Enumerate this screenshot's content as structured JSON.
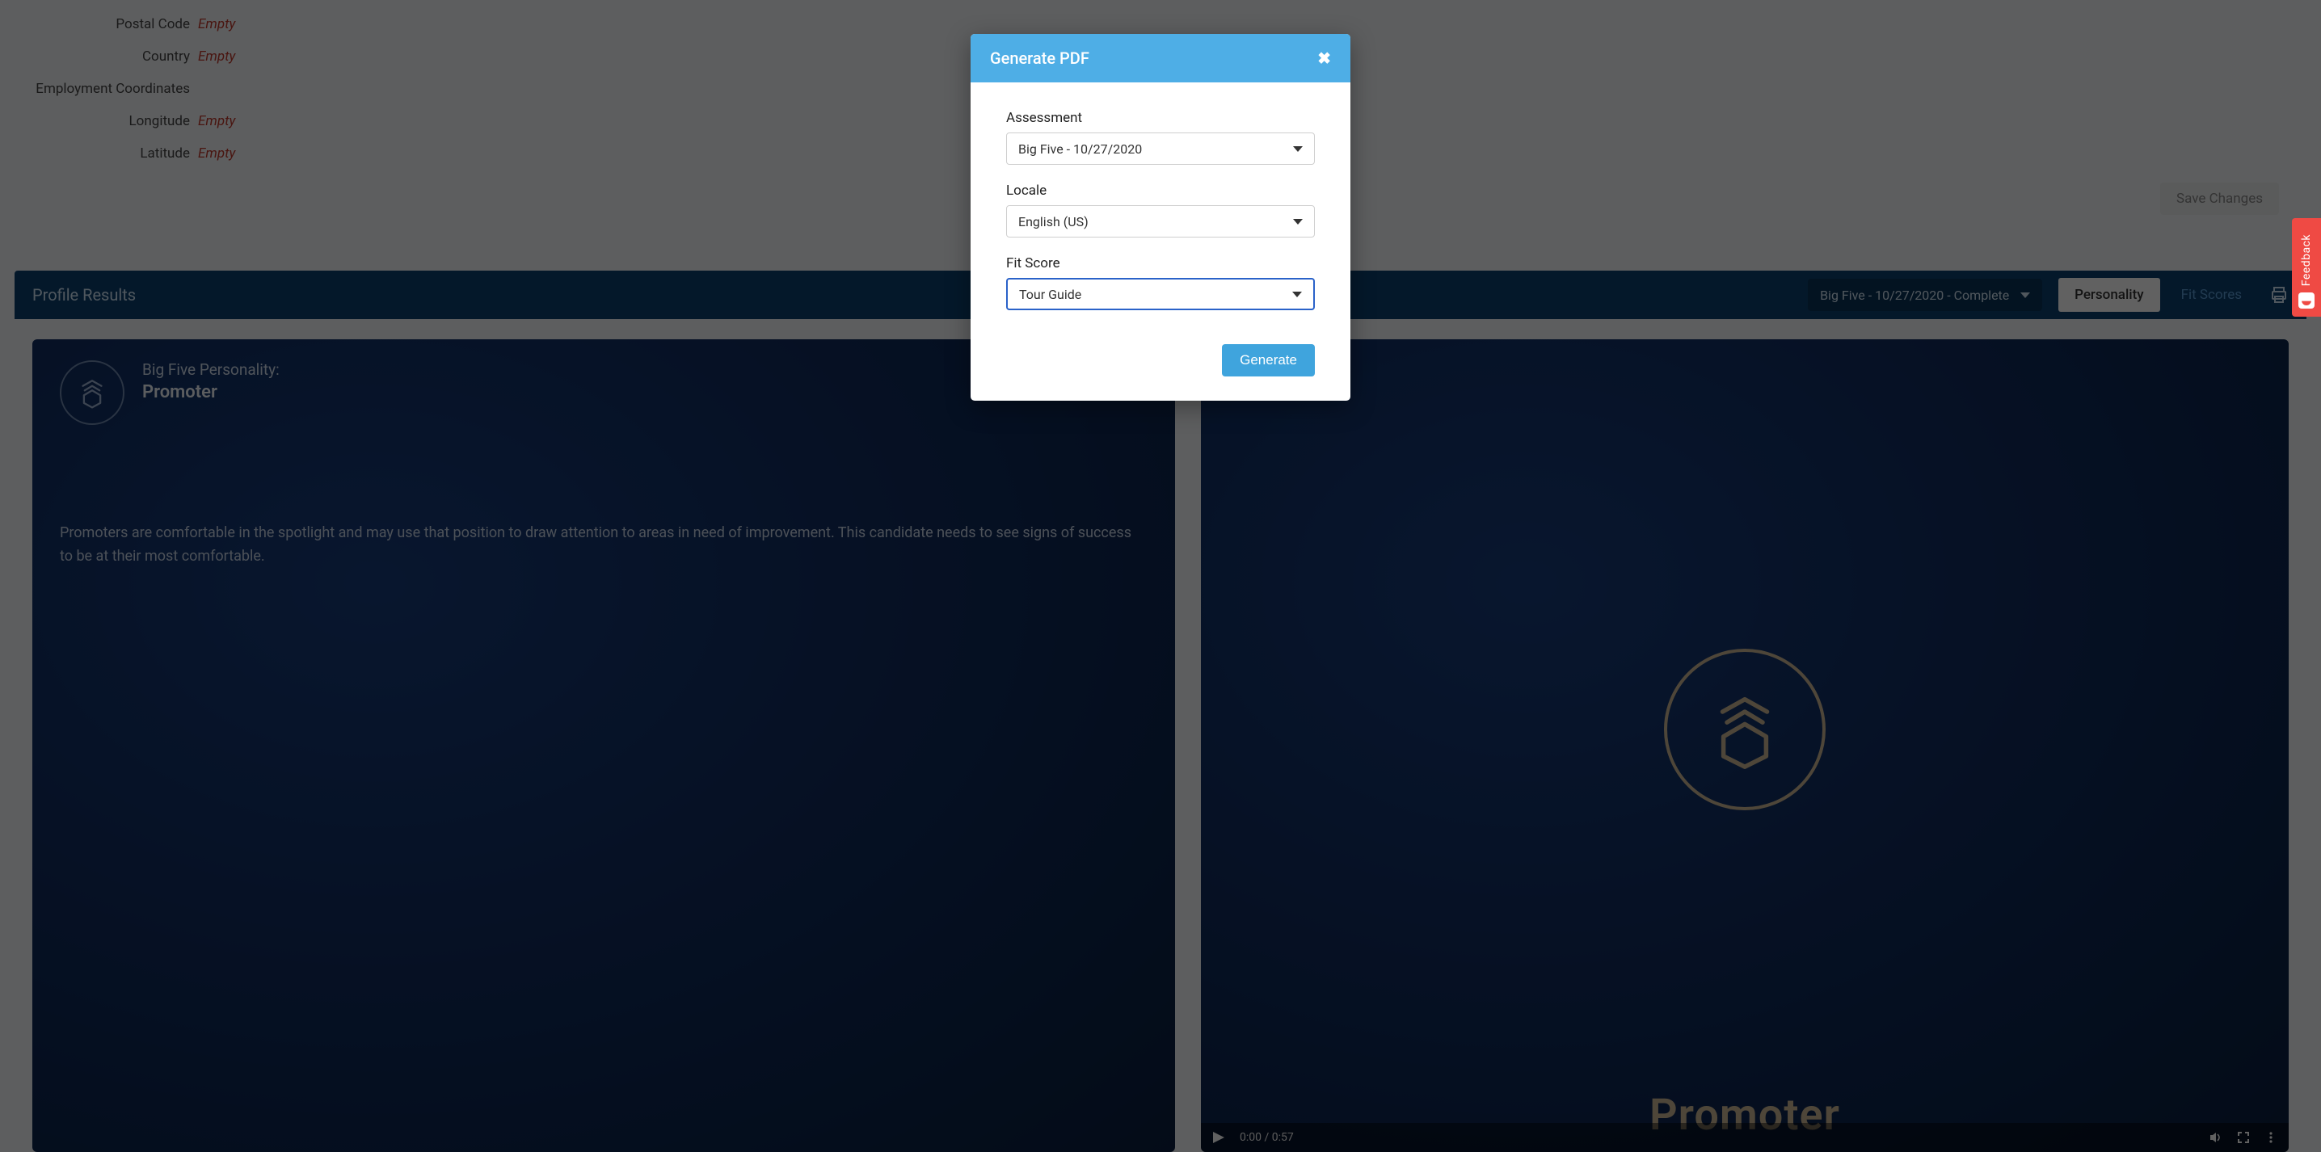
{
  "form": {
    "rows": [
      {
        "label": "Postal Code",
        "value": "Empty"
      },
      {
        "label": "Country",
        "value": "Empty"
      }
    ],
    "section_label": "Employment Coordinates",
    "coord_rows": [
      {
        "label": "Longitude",
        "value": "Empty"
      },
      {
        "label": "Latitude",
        "value": "Empty"
      }
    ],
    "save_label": "Save Changes"
  },
  "results": {
    "heading": "Profile Results",
    "status_selected": "Big Five - 10/27/2020 - Complete",
    "tabs": {
      "personality": "Personality",
      "fit_scores": "Fit Scores"
    }
  },
  "panel_left": {
    "subtitle": "Big Five Personality:",
    "title": "Promoter",
    "body": "Promoters are comfortable in the spotlight and may use that position to draw attention to areas in need of improvement. This candidate needs to see signs of success to be at their most comfortable."
  },
  "panel_video": {
    "big_label": "Promoter",
    "time": "0:00 / 0:57"
  },
  "feedback": {
    "label": "Feedback"
  },
  "modal": {
    "title": "Generate PDF",
    "fields": {
      "assessment_label": "Assessment",
      "assessment_value": "Big Five - 10/27/2020",
      "locale_label": "Locale",
      "locale_value": "English (US)",
      "fitscore_label": "Fit Score",
      "fitscore_value": "Tour Guide"
    },
    "generate_label": "Generate"
  }
}
